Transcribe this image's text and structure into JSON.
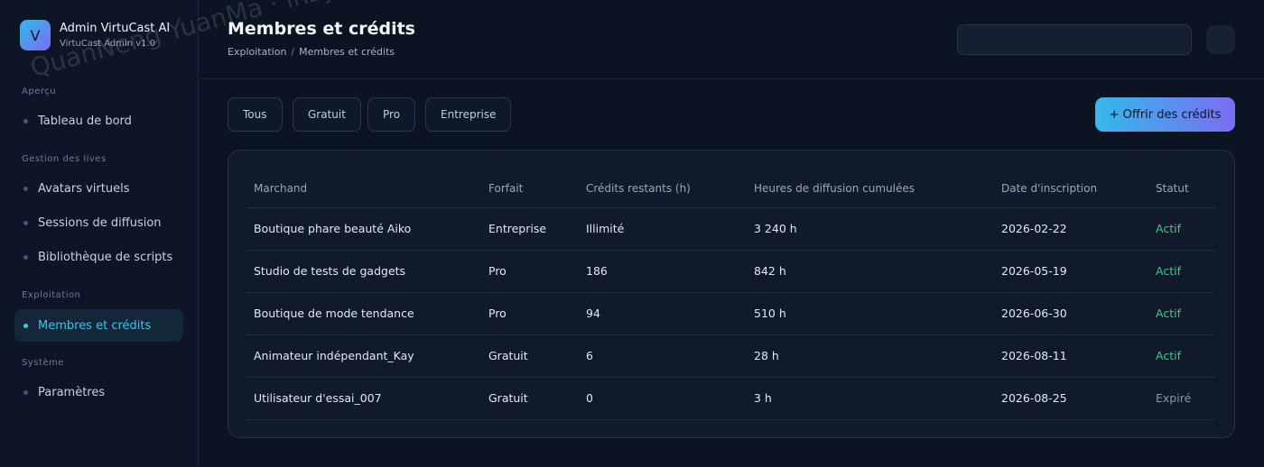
{
  "brand": {
    "logo_letter": "V",
    "title": "Admin VirtuCast AI",
    "subtitle": "VirtuCast Admin v1.0"
  },
  "sidebar": {
    "sections": [
      {
        "label": "Aperçu"
      },
      {
        "label": "Gestion des lives"
      },
      {
        "label": "Exploitation"
      },
      {
        "label": "Système"
      }
    ],
    "items": [
      {
        "label": "Tableau de bord"
      },
      {
        "label": "Avatars virtuels"
      },
      {
        "label": "Sessions de diffusion"
      },
      {
        "label": "Bibliothèque de scripts"
      },
      {
        "label": "Membres et crédits",
        "active": true
      },
      {
        "label": "Paramètres"
      }
    ]
  },
  "header": {
    "title": "Membres et crédits",
    "breadcrumb": {
      "parent": "Exploitation",
      "separator": "/",
      "current": "Membres et crédits"
    },
    "search": {
      "placeholder": ""
    }
  },
  "filters": {
    "tabs": [
      "Tous",
      "Gratuit",
      "Pro",
      "Entreprise"
    ]
  },
  "actions": {
    "offer_credits": "+ Offrir des crédits"
  },
  "table": {
    "columns": [
      "Marchand",
      "Forfait",
      "Crédits restants (h)",
      "Heures de diffusion cumulées",
      "Date d'inscription",
      "Statut"
    ],
    "rows": [
      [
        "Boutique phare beauté Aiko",
        "Entreprise",
        "Illimité",
        "3 240 h",
        "2026-02-22",
        "Actif"
      ],
      [
        "Studio de tests de gadgets",
        "Pro",
        "186",
        "842 h",
        "2026-05-19",
        "Actif"
      ],
      [
        "Boutique de mode tendance",
        "Pro",
        "94",
        "510 h",
        "2026-06-30",
        "Actif"
      ],
      [
        "Animateur indépendant_Kay",
        "Gratuit",
        "6",
        "28 h",
        "2026-08-11",
        "Actif"
      ],
      [
        "Utilisateur d'essai_007",
        "Gratuit",
        "0",
        "3 h",
        "2026-08-25",
        "Expiré"
      ]
    ]
  },
  "watermark": "QuanNeng YuanMa · inzyxuashop.com",
  "colors": {
    "accent": "#3cc6e8",
    "gradient_start": "#34b9e8",
    "gradient_end": "#7b6df3",
    "status_active": "#3fc78b",
    "status_expired": "#8b95a6",
    "background": "#0c1424"
  }
}
